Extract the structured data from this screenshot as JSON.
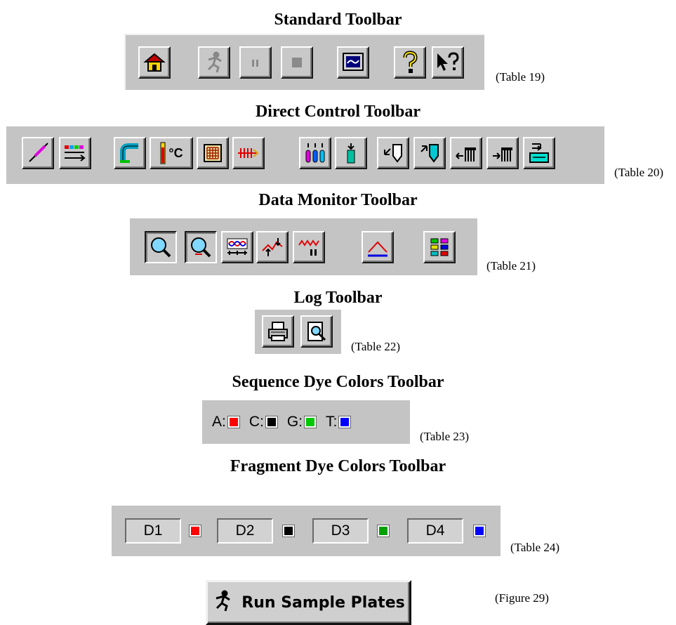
{
  "standard": {
    "title": "Standard Toolbar",
    "ref": "(Table 19)",
    "icons": [
      "home-icon",
      "run-icon",
      "pause-icon",
      "stop-icon",
      "monitor-icon",
      "help-icon",
      "context-help-icon"
    ]
  },
  "direct": {
    "title": "Direct Control Toolbar",
    "ref": "(Table 20)",
    "icons": [
      "syringe-icon",
      "gel-icon",
      "pump-icon",
      "temperature-icon",
      "plate-icon",
      "electrode-icon",
      "tubes-icon",
      "tube-icon",
      "tip-out-icon",
      "tip-in-icon",
      "comb-left-icon",
      "comb-right-icon",
      "buffer-icon"
    ],
    "temp_label": "°C"
  },
  "monitor": {
    "title": "Data Monitor Toolbar",
    "ref": "(Table 21)",
    "icons": [
      "zoom-in-icon",
      "zoom-out-icon",
      "scan-icon",
      "arrows-icon",
      "signal-icon",
      "baseline-icon",
      "grid-icon"
    ]
  },
  "log": {
    "title": "Log Toolbar",
    "ref": "(Table 22)",
    "icons": [
      "print-icon",
      "print-preview-icon"
    ]
  },
  "sequence": {
    "title": "Sequence Dye Colors Toolbar",
    "ref": "(Table 23)",
    "dyes": [
      {
        "label": "A:",
        "color": "#ff0000"
      },
      {
        "label": "C:",
        "color": "#000000"
      },
      {
        "label": "G:",
        "color": "#00c800"
      },
      {
        "label": "T:",
        "color": "#0000ff"
      }
    ]
  },
  "fragment": {
    "title": "Fragment Dye Colors Toolbar",
    "ref": "(Table 24)",
    "dyes": [
      {
        "label": "D1",
        "color": "#ff0000"
      },
      {
        "label": "D2",
        "color": "#000000"
      },
      {
        "label": "D3",
        "color": "#00a000"
      },
      {
        "label": "D4",
        "color": "#0000ff"
      }
    ]
  },
  "run": {
    "label": "Run Sample Plates",
    "ref": "(Figure 29)"
  }
}
